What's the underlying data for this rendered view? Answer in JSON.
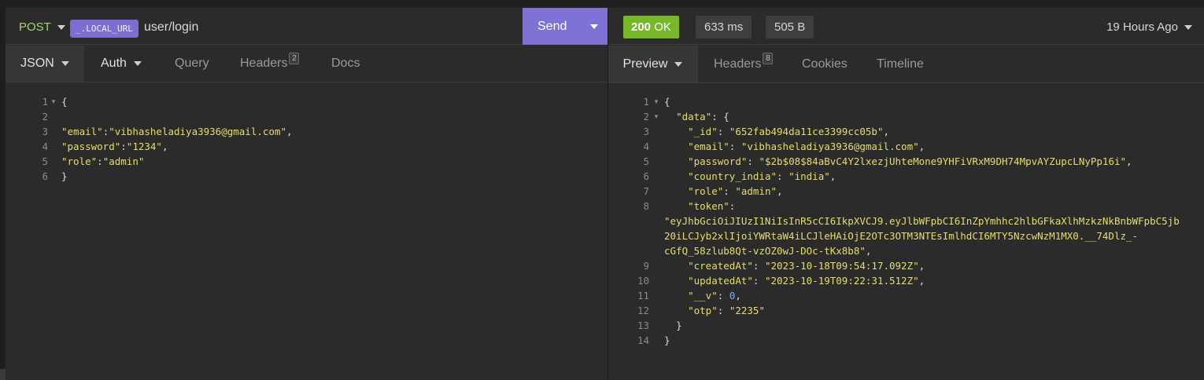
{
  "request": {
    "method": "POST",
    "env_tag": "_.LOCAL_URL",
    "path": "user/login",
    "send_label": "Send"
  },
  "request_tabs": {
    "json": "JSON",
    "auth": "Auth",
    "query": "Query",
    "headers": "Headers",
    "headers_count": "2",
    "docs": "Docs"
  },
  "request_body": {
    "lines": [
      {
        "num": "1",
        "text": "{"
      },
      {
        "num": "2",
        "text": ""
      },
      {
        "num": "3",
        "key": "\"email\"",
        "sep": ":",
        "value": "\"vibhasheladiya3936@gmail.com\"",
        "end": ","
      },
      {
        "num": "4",
        "key": "\"password\"",
        "sep": ":",
        "value": "\"1234\"",
        "end": ","
      },
      {
        "num": "5",
        "key": "\"role\"",
        "sep": ":",
        "value": "\"admin\"",
        "end": ""
      },
      {
        "num": "6",
        "text": "}"
      }
    ]
  },
  "response": {
    "status_code": "200",
    "status_text": "OK",
    "time": "633 ms",
    "size": "505 B",
    "ago": "19 Hours Ago"
  },
  "response_tabs": {
    "preview": "Preview",
    "headers": "Headers",
    "headers_count": "8",
    "cookies": "Cookies",
    "timeline": "Timeline"
  },
  "response_body": {
    "l1": "{",
    "l2_key": "\"data\"",
    "l2_rest": ": {",
    "id_key": "\"_id\"",
    "id_val": "\"652fab494da11ce3399cc05b\"",
    "email_key": "\"email\"",
    "email_val": "\"vibhasheladiya3936@gmail.com\"",
    "password_key": "\"password\"",
    "password_val": "\"$2b$08$84aBvC4Y2lxezjUhteMone9YHFiVRxM9DH74MpvAYZupcLNyPp16i\"",
    "country_key": "\"country_india\"",
    "country_val": "\"india\"",
    "role_key": "\"role\"",
    "role_val": "\"admin\"",
    "token_key": "\"token\"",
    "token_line1": "\"eyJhbGciOiJIUzI1NiIsInR5cCI6IkpXVCJ9.eyJlbWFpbCI6InZpYmhhc2hlbGFkaXlhMzkzNkBnbWFpbC5jb",
    "token_line2": "20iLCJyb2xlIjoiYWRtaW4iLCJleHAiOjE2OTc3OTM3NTEsImlhdCI6MTY5NzcwNzM1MX0.__74Dlz_-",
    "token_line3": "cGfQ_58zlub8Qt-vzOZ0wJ-DOc-tKx8b8\"",
    "created_key": "\"createdAt\"",
    "created_val": "\"2023-10-18T09:54:17.092Z\"",
    "updated_key": "\"updatedAt\"",
    "updated_val": "\"2023-10-19T09:22:31.512Z\"",
    "v_key": "\"__v\"",
    "v_val": "0",
    "otp_key": "\"otp\"",
    "otp_val": "\"2235\"",
    "l13": "}",
    "l14": "}",
    "line_numbers": [
      "1",
      "2",
      "3",
      "4",
      "5",
      "6",
      "7",
      "8",
      "9",
      "10",
      "11",
      "12",
      "13",
      "14"
    ]
  },
  "colors": {
    "accent": "#7e72d4",
    "status_ok": "#76b82a",
    "method_post": "#a5d46a",
    "json_string": "#e6dd6b",
    "json_number": "#7aa9f0"
  }
}
